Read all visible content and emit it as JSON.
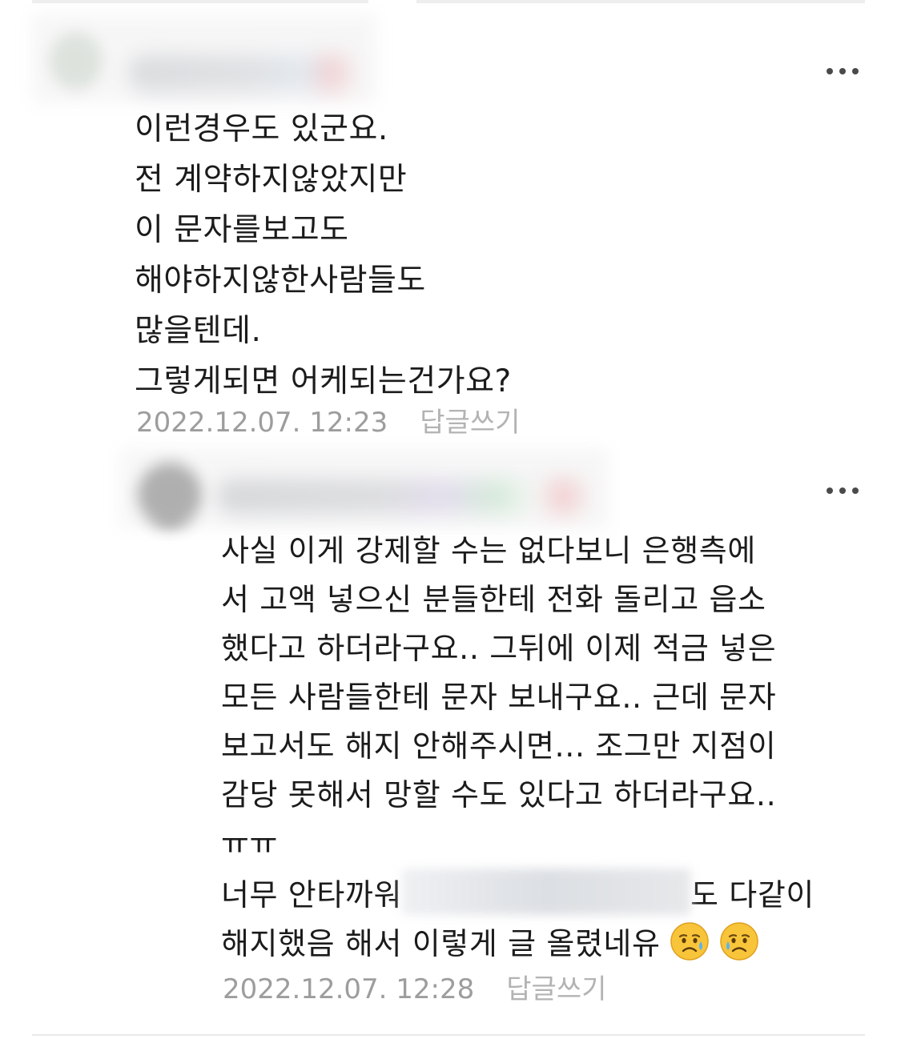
{
  "comments": [
    {
      "lines": [
        "이런경우도 있군요.",
        "전 계약하지않았지만",
        "이 문자를보고도",
        "해야하지않한사람들도",
        "많을텐데.",
        "그렇게되면 어케되는건가요?"
      ],
      "date": "2022.12.07. 12:23",
      "reply_label": "답글쓰기"
    },
    {
      "lines": [
        "사실 이게 강제할 수는 없다보니 은행측에",
        "서 고액 넣으신 분들한테 전화 돌리고 읍소",
        "했다고 하더라구요.. 그뒤에 이제 적금 넣은",
        "모든 사람들한테 문자 보내구요.. 근데 문자",
        "보고서도 해지 안해주시면... 조그만 지점이",
        "감당 못해서 망할 수도 있다고 하더라구요..",
        "ㅠㅠ"
      ],
      "line8_start": "너무 안타까워",
      "line8_end": "도 다같이",
      "line9": "해지했음 해서 이렇게 글 올렸네유",
      "emoji": "sad-relieved-face",
      "date": "2022.12.07. 12:28",
      "reply_label": "답글쓰기"
    }
  ],
  "colors": {
    "text": "#1b1b1b",
    "date": "#9d9d9d",
    "reply": "#b3b3b3",
    "more_dots": "#4a4a4a"
  },
  "icons": [
    "more-options-icon",
    "avatar",
    "sad-face-emoji"
  ]
}
